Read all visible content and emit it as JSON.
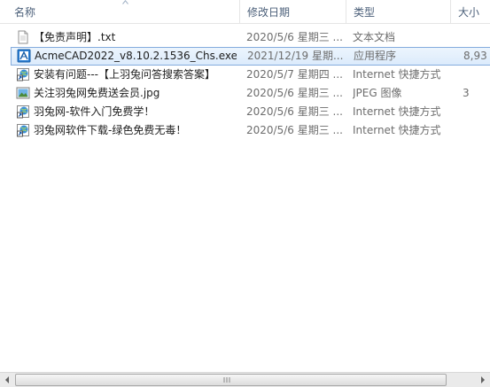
{
  "columns": {
    "name": "名称",
    "date": "修改日期",
    "type": "类型",
    "size": "大小"
  },
  "files": [
    {
      "name": "【免责声明】.txt",
      "date": "2020/5/6 星期三 ...",
      "type": "文本文档",
      "size": "",
      "icon": "text-file-icon"
    },
    {
      "name": "AcmeCAD2022_v8.10.2.1536_Chs.exe",
      "date": "2021/12/19 星期...",
      "type": "应用程序",
      "size": "8,93",
      "icon": "exe-app-icon"
    },
    {
      "name": "安装有问题---【上羽兔问答搜索答案】",
      "date": "2020/5/7 星期四 ...",
      "type": "Internet 快捷方式",
      "size": "",
      "icon": "internet-shortcut-icon"
    },
    {
      "name": "关注羽兔网免费送会员.jpg",
      "date": "2020/5/6 星期三 ...",
      "type": "JPEG 图像",
      "size": "3",
      "icon": "jpeg-image-icon"
    },
    {
      "name": "羽兔网-软件入门免费学！",
      "date": "2020/5/6 星期三 ...",
      "type": "Internet 快捷方式",
      "size": "",
      "icon": "internet-shortcut-icon"
    },
    {
      "name": "羽兔网软件下载-绿色免费无毒！",
      "date": "2020/5/6 星期三 ...",
      "type": "Internet 快捷方式",
      "size": "",
      "icon": "internet-shortcut-icon"
    }
  ],
  "selected_index": 1,
  "colors": {
    "header_text": "#4c607a",
    "selection_border": "#84acdd",
    "selection_fill": "#dcebfc",
    "secondary_text": "#6d6d6d"
  }
}
